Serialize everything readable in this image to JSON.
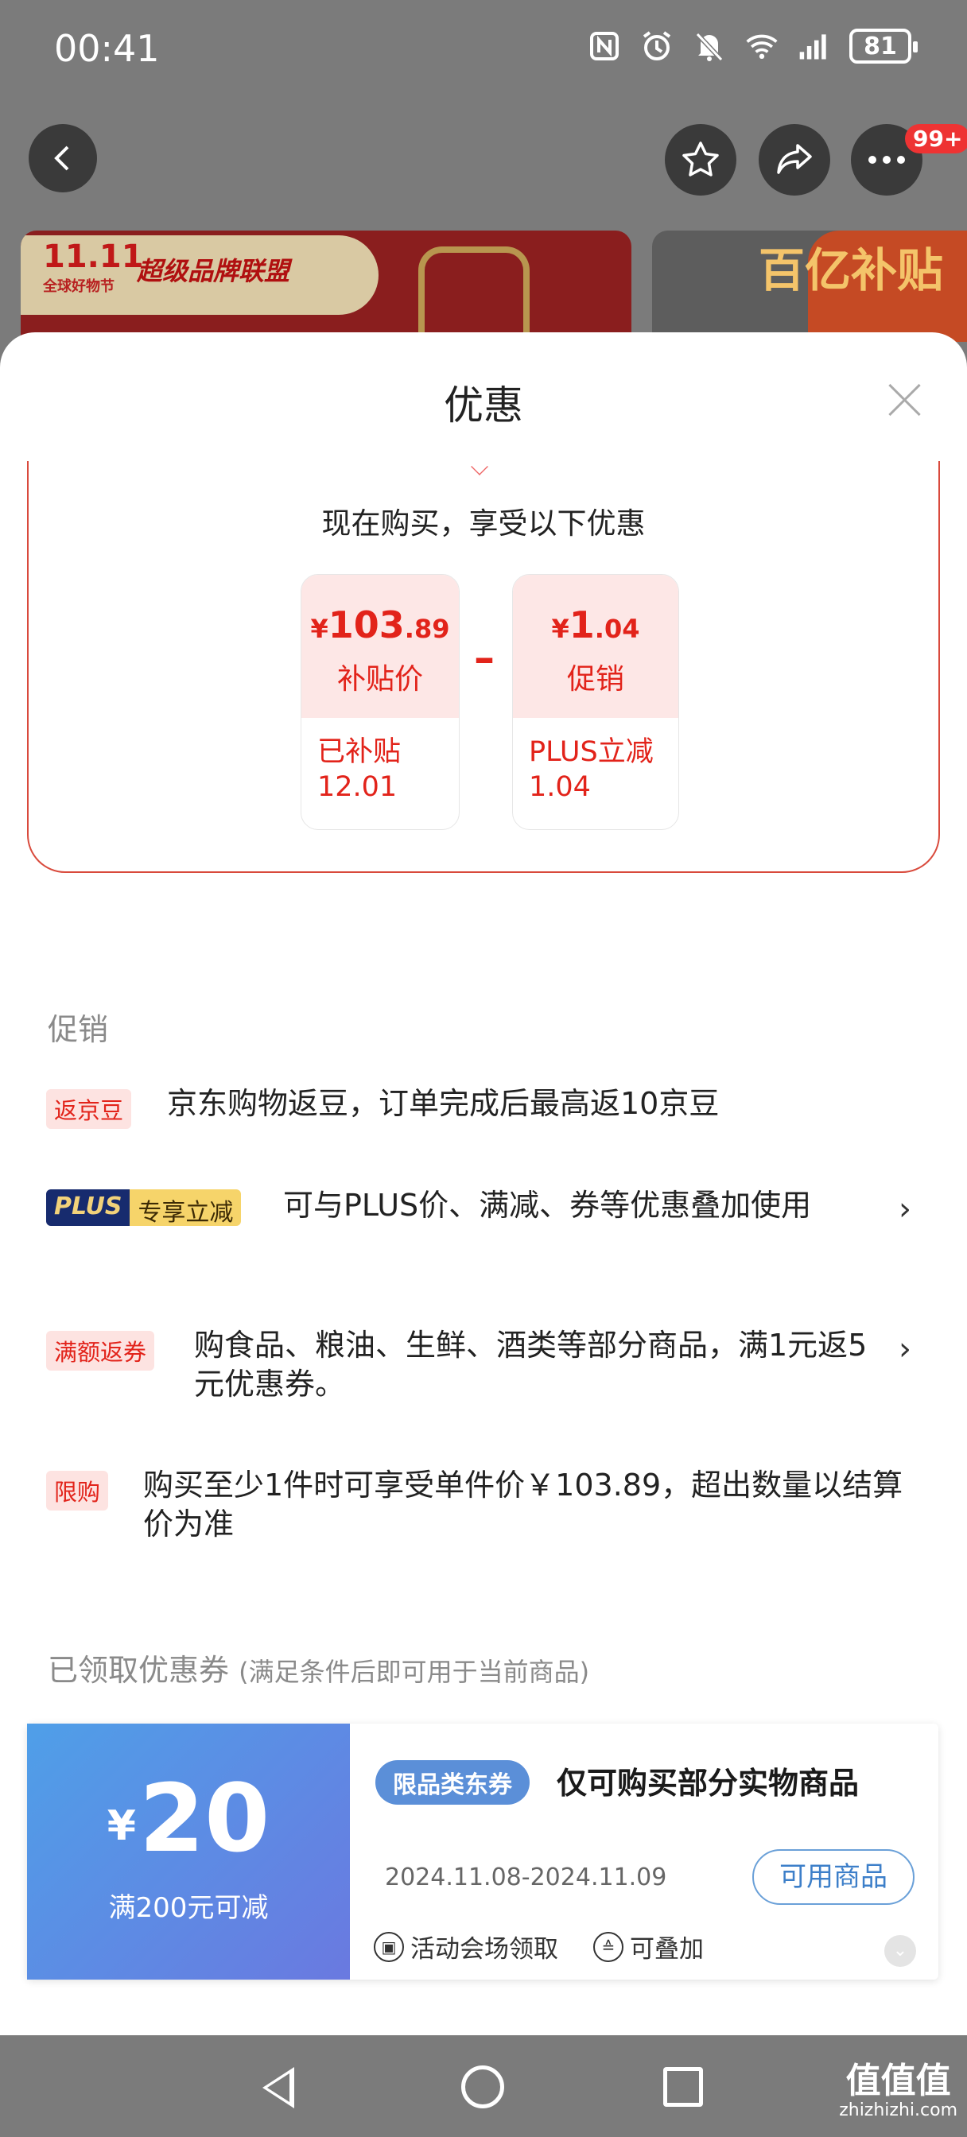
{
  "status_bar": {
    "time": "00:41",
    "battery": "81"
  },
  "top_nav": {
    "cart_badge": "99+"
  },
  "banner": {
    "event": "11.11",
    "event_sub": "全球好物节",
    "brand": "超级品牌联盟",
    "subsidy": "百亿补贴"
  },
  "sheet": {
    "title": "优惠",
    "intro": "现在购买，享受以下优惠",
    "price_card": {
      "yen": "¥",
      "int": "103",
      "dec": ".89",
      "label": "补贴价",
      "note": "已补贴 12.01"
    },
    "minus": "–",
    "promo_card": {
      "yen": "¥",
      "int": "1",
      "dec": ".04",
      "label": "促销",
      "note": "PLUS立减 1.04"
    }
  },
  "promotions": {
    "section_title": "促销",
    "items": [
      {
        "tag": "返京豆",
        "text": "京东购物返豆，订单完成后最高返10京豆"
      },
      {
        "tag_a": "PLUS",
        "tag_b": "专享立减",
        "text": "可与PLUS价、满减、券等优惠叠加使用"
      },
      {
        "tag": "满额返券",
        "text": "购食品、粮油、生鲜、酒类等部分商品，满1元返5元优惠券。"
      },
      {
        "tag": "限购",
        "text": "购买至少1件时可享受单件价￥103.89，超出数量以结算价为准"
      }
    ]
  },
  "coupons": {
    "section_title": "已领取优惠券",
    "section_note": "(满足条件后即可用于当前商品)",
    "coupon": {
      "yen": "¥",
      "amount": "20",
      "condition": "满200元可减",
      "category_tag": "限品类东券",
      "title": "仅可购买部分实物商品",
      "date": "2024.11.08-2024.11.09",
      "button": "可用商品",
      "source": "活动会场领取",
      "stack": "可叠加"
    }
  },
  "watermark": {
    "main": "值值值",
    "sub": "zhizhizhi.com"
  }
}
